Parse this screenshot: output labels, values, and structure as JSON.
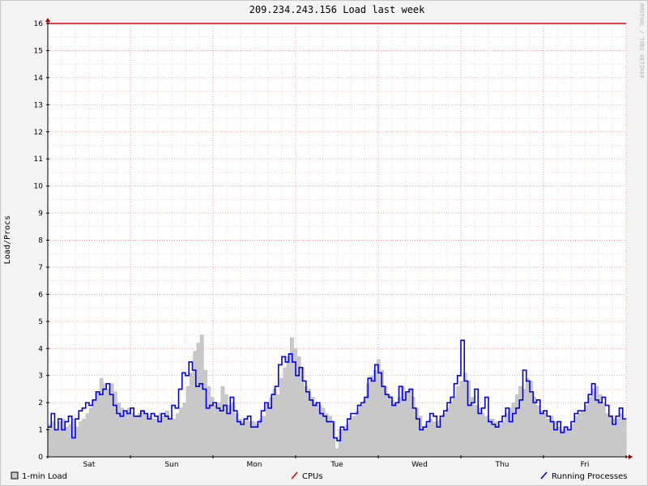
{
  "chart_data": {
    "type": "area",
    "title": "209.234.243.156 Load last week",
    "ylabel": "Load/Procs",
    "xlabel": "",
    "ylim": [
      0,
      16
    ],
    "yticks": [
      0,
      1,
      2,
      3,
      4,
      5,
      6,
      7,
      8,
      9,
      10,
      11,
      12,
      13,
      14,
      15,
      16
    ],
    "xticks": [
      "Sat",
      "Sun",
      "Mon",
      "Tue",
      "Wed",
      "Thu",
      "Fri"
    ],
    "grid": true,
    "cpus": 16,
    "watermark": "RRDTOOL / TOBI OETIKER",
    "series": [
      {
        "name": "1-min Load",
        "color": "#c8c8c8",
        "values": [
          1.2,
          1.3,
          1.0,
          1.3,
          1.4,
          1.1,
          1.2,
          1.4,
          1.1,
          1.3,
          1.4,
          1.6,
          1.8,
          2.1,
          2.4,
          2.9,
          2.7,
          2.5,
          2.7,
          2.4,
          2.0,
          1.8,
          1.7,
          1.8,
          1.6,
          1.5,
          1.6,
          1.7,
          1.6,
          1.5,
          1.4,
          1.4,
          1.6,
          1.5,
          1.7,
          1.4,
          1.4,
          1.6,
          1.8,
          2.0,
          2.6,
          3.1,
          3.9,
          4.2,
          4.5,
          3.2,
          2.6,
          2.2,
          1.9,
          2.0,
          2.6,
          2.3,
          1.9,
          2.0,
          1.6,
          1.4,
          1.3,
          1.4,
          1.3,
          1.3,
          1.2,
          1.4,
          1.5,
          2.0,
          2.2,
          2.5,
          2.3,
          2.9,
          3.3,
          3.7,
          4.4,
          4.0,
          3.7,
          3.3,
          2.6,
          2.5,
          2.2,
          2.0,
          1.9,
          1.8,
          1.6,
          1.5,
          1.3,
          0.3,
          1.0,
          1.0,
          1.2,
          1.4,
          1.5,
          1.7,
          1.9,
          2.1,
          2.7,
          3.0,
          3.2,
          3.6,
          3.2,
          2.6,
          2.3,
          2.1,
          2.0,
          2.2,
          2.6,
          2.4,
          2.5,
          2.2,
          1.8,
          1.5,
          1.1,
          1.2,
          1.4,
          1.3,
          1.3,
          1.4,
          1.6,
          1.8,
          2.0,
          2.2,
          2.6,
          2.8,
          3.1,
          2.8,
          2.2,
          1.9,
          1.8,
          1.6,
          1.5,
          1.4,
          1.4,
          1.3,
          1.2,
          1.3,
          1.6,
          1.8,
          2.0,
          2.3,
          2.6,
          2.5,
          2.9,
          2.8,
          2.2,
          1.9,
          1.7,
          1.6,
          1.4,
          1.5,
          1.3,
          1.1,
          1.0,
          1.1,
          1.0,
          1.2,
          1.5,
          1.6,
          1.7,
          1.9,
          2.2,
          2.5,
          2.6,
          2.3,
          2.0,
          1.6,
          1.5,
          1.4,
          1.4,
          1.6,
          1.4
        ]
      },
      {
        "name": "CPUs",
        "color": "#ee0000",
        "values": [
          16
        ]
      },
      {
        "name": "Running Processes",
        "color": "#0000ee",
        "values": [
          1.1,
          1.6,
          1.0,
          1.4,
          1.0,
          1.3,
          1.5,
          0.7,
          1.4,
          1.7,
          1.8,
          2.0,
          1.9,
          2.1,
          2.4,
          2.3,
          2.5,
          2.7,
          2.3,
          1.9,
          1.6,
          1.5,
          1.7,
          1.6,
          1.8,
          1.5,
          1.5,
          1.7,
          1.6,
          1.4,
          1.6,
          1.5,
          1.3,
          1.6,
          1.5,
          1.4,
          1.9,
          1.8,
          2.5,
          3.1,
          3.0,
          3.5,
          3.2,
          2.6,
          2.7,
          2.5,
          1.8,
          1.9,
          2.0,
          1.8,
          1.7,
          1.9,
          1.6,
          2.2,
          1.7,
          1.3,
          1.2,
          1.4,
          1.5,
          1.1,
          1.1,
          1.3,
          1.7,
          2.0,
          1.8,
          2.3,
          2.6,
          3.4,
          3.7,
          3.5,
          3.8,
          3.5,
          3.0,
          3.3,
          2.8,
          2.4,
          2.1,
          1.9,
          2.0,
          1.6,
          1.5,
          1.3,
          1.3,
          0.7,
          0.6,
          1.1,
          1.0,
          1.4,
          1.6,
          1.6,
          1.9,
          2.0,
          2.2,
          2.9,
          2.8,
          3.4,
          3.1,
          2.6,
          2.3,
          2.2,
          1.9,
          2.0,
          2.6,
          2.1,
          2.4,
          2.5,
          1.8,
          1.4,
          1.0,
          1.1,
          1.3,
          1.6,
          1.5,
          1.1,
          1.5,
          1.7,
          2.0,
          2.2,
          2.7,
          3.0,
          4.3,
          2.8,
          1.9,
          2.0,
          2.5,
          1.6,
          1.8,
          2.2,
          1.3,
          1.2,
          1.1,
          1.3,
          1.5,
          1.8,
          1.3,
          1.6,
          1.8,
          2.1,
          3.2,
          2.8,
          2.4,
          2.0,
          2.1,
          1.6,
          1.7,
          1.5,
          1.3,
          1.0,
          1.3,
          0.9,
          1.1,
          1.0,
          1.3,
          1.6,
          1.7,
          1.7,
          2.0,
          2.3,
          2.7,
          2.1,
          2.0,
          2.2,
          1.9,
          1.5,
          1.2,
          1.5,
          1.8,
          1.4
        ]
      }
    ],
    "legend": [
      {
        "label": "1-min Load",
        "color": "#c8c8c8",
        "swatch": "box"
      },
      {
        "label": "CPUs",
        "color": "#ee0000",
        "swatch": "line"
      },
      {
        "label": "Running Processes",
        "color": "#0000ee",
        "swatch": "line"
      }
    ]
  }
}
